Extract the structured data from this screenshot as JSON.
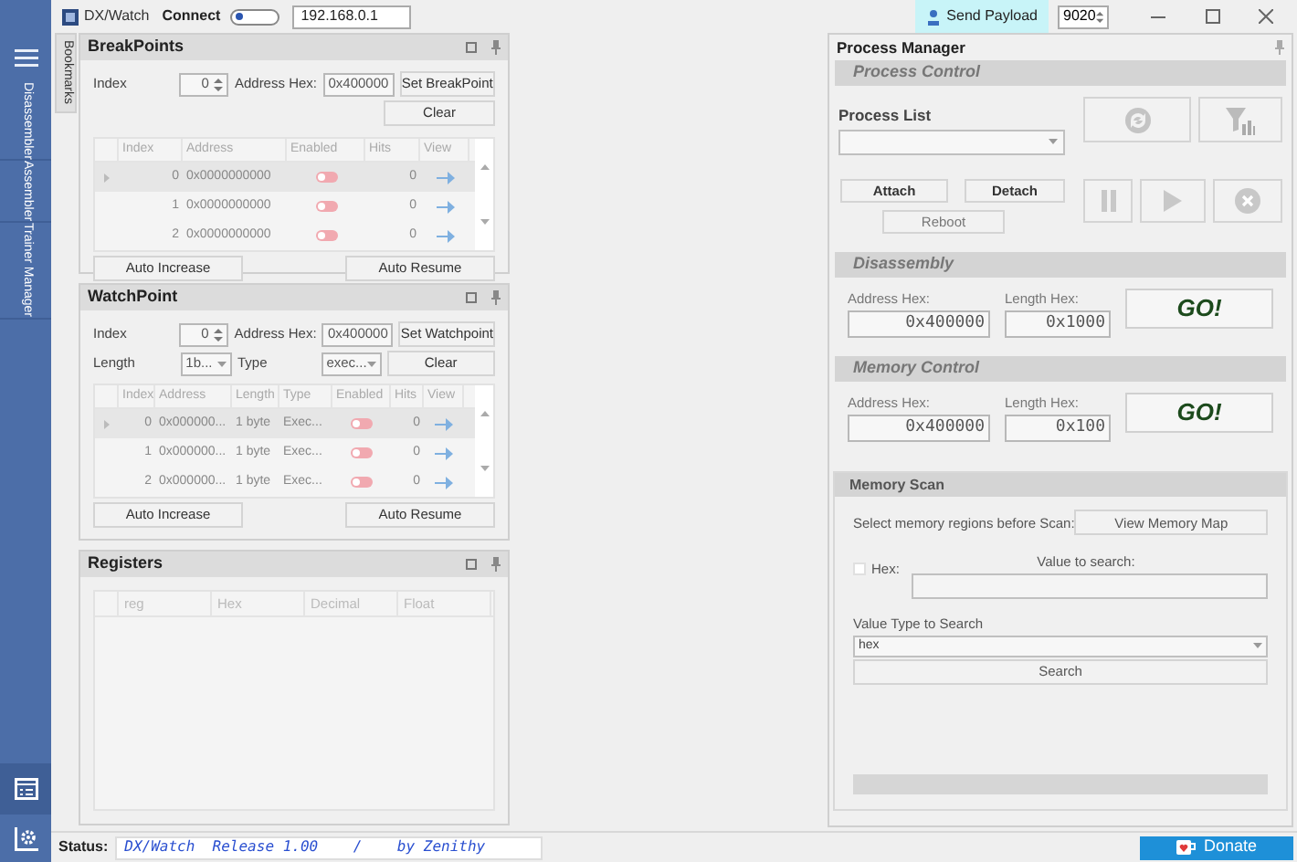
{
  "title_bar": {
    "app_name": "DX/Watch",
    "connect_label": "Connect",
    "connected": false,
    "ip": "192.168.0.1",
    "send_payload": "Send Payload",
    "port": "9020"
  },
  "sidebar": {
    "tabs": [
      {
        "label": "Disassembler",
        "selected": false
      },
      {
        "label": "Assembler",
        "selected": false
      },
      {
        "label": "Trainer Manager",
        "selected": false
      }
    ]
  },
  "bookmarks_tab": "Bookmarks",
  "breakpoints": {
    "title": "BreakPoints",
    "index_label": "Index",
    "index": "0",
    "address_label": "Address Hex:",
    "address": "0x400000",
    "set_button": "Set BreakPoint",
    "clear_button": "Clear",
    "columns": [
      "Index",
      "Address",
      "Enabled",
      "Hits",
      "View"
    ],
    "rows": [
      {
        "index": "0",
        "address": "0x0000000000",
        "enabled": false,
        "hits": "0",
        "selected": true
      },
      {
        "index": "1",
        "address": "0x0000000000",
        "enabled": false,
        "hits": "0",
        "selected": false
      },
      {
        "index": "2",
        "address": "0x0000000000",
        "enabled": false,
        "hits": "0",
        "selected": false
      }
    ],
    "buttons": [
      "Auto Increase",
      "Auto Resume"
    ]
  },
  "watchpoint": {
    "title": "WatchPoint",
    "index_label": "Index",
    "index": "0",
    "address_label": "Address Hex:",
    "address": "0x400000",
    "set_button": "Set Watchpoint",
    "length_label": "Length",
    "length": "1b...",
    "type_label": "Type",
    "type": "exec...",
    "clear_button": "Clear",
    "columns": [
      "Index",
      "Address",
      "Length",
      "Type",
      "Enabled",
      "Hits",
      "View"
    ],
    "rows": [
      {
        "index": "0",
        "address": "0x000000...",
        "length": "1 byte",
        "type": "Exec...",
        "enabled": false,
        "hits": "0",
        "selected": true
      },
      {
        "index": "1",
        "address": "0x000000...",
        "length": "1 byte",
        "type": "Exec...",
        "enabled": false,
        "hits": "0",
        "selected": false
      },
      {
        "index": "2",
        "address": "0x000000...",
        "length": "1 byte",
        "type": "Exec...",
        "enabled": false,
        "hits": "0",
        "selected": false
      }
    ],
    "buttons": [
      "Auto Increase",
      "Auto Resume"
    ]
  },
  "registers": {
    "title": "Registers",
    "columns": [
      "reg",
      "Hex",
      "Decimal",
      "Float"
    ]
  },
  "process_manager": {
    "title": "Process Manager",
    "process_control": {
      "title": "Process Control",
      "process_list_label": "Process List",
      "attach": "Attach",
      "detach": "Detach",
      "reboot": "Reboot"
    },
    "disassembly": {
      "title": "Disassembly",
      "address_label": "Address Hex:",
      "address": "0x400000",
      "length_label": "Length Hex:",
      "length": "0x1000",
      "go": "GO!"
    },
    "memory_control": {
      "title": "Memory Control",
      "address_label": "Address Hex:",
      "address": "0x400000",
      "length_label": "Length Hex:",
      "length": "0x100",
      "go": "GO!"
    },
    "memory_scan": {
      "title": "Memory Scan",
      "select_label": "Select memory regions  before Scan:",
      "view_map": "View Memory Map",
      "hex_label": "Hex:",
      "hex_checked": false,
      "value_label": "Value to search:",
      "type_label": "Value Type to Search",
      "type_value": "hex",
      "search": "Search"
    }
  },
  "status": {
    "label": "Status:",
    "text": "DX/Watch  Release 1.00    /    by Zenithy"
  },
  "donate": "Donate"
}
